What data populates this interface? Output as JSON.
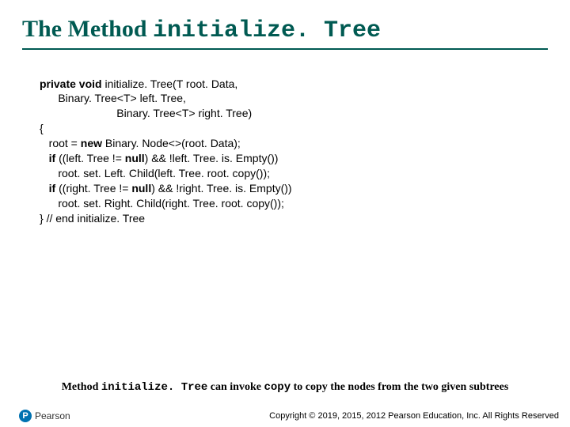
{
  "title": {
    "prefix": "The Method ",
    "mono": "initialize. Tree"
  },
  "code": {
    "l1_kw": "private void ",
    "l1_rest": "initialize. Tree(T root. Data,",
    "l2": "Binary. Tree<T> left. Tree,",
    "l3": "Binary. Tree<T> right. Tree)",
    "l4": "{",
    "l5a": "root = ",
    "l5_kw": "new ",
    "l5b": "Binary. Node<>(root. Data);",
    "l6_kw": "if ",
    "l6_rest": "((left. Tree != ",
    "l6_null": "null",
    "l6_rest2": ") && !left. Tree. is. Empty())",
    "l7": "root. set. Left. Child(left. Tree. root. copy());",
    "l8_kw": "if ",
    "l8_rest": "((right. Tree != ",
    "l8_null": "null",
    "l8_rest2": ") && !right. Tree. is. Empty())",
    "l9": "root. set. Right. Child(right. Tree. root. copy());",
    "l10": "} // end initialize. Tree"
  },
  "caption": {
    "p1": "Method ",
    "m1": "initialize. Tree",
    "p2": " can invoke ",
    "m2": "copy",
    "p3": " to copy the nodes from the two given subtrees"
  },
  "footer": {
    "logo_initial": "P",
    "logo_text": "Pearson",
    "copyright": "Copyright © 2019, 2015, 2012 Pearson Education, Inc. All Rights Reserved"
  }
}
